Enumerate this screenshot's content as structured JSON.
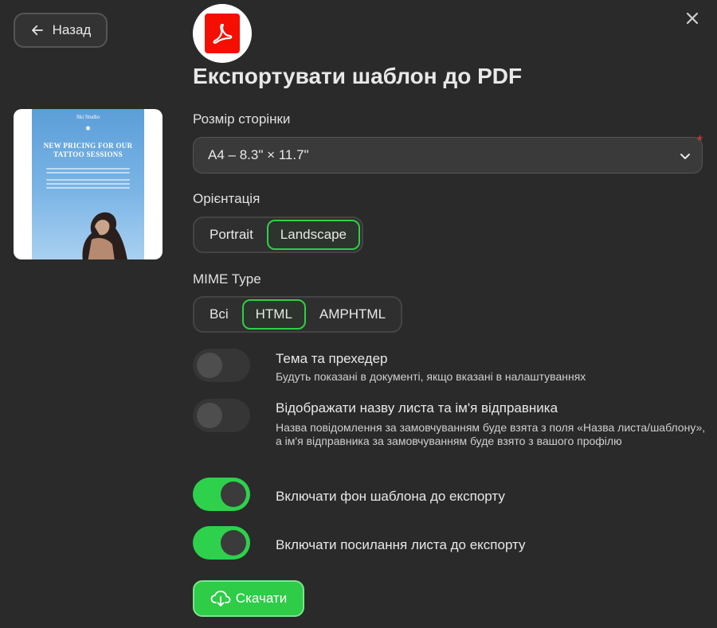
{
  "header": {
    "back_label": "Назад",
    "title": "Експортувати шаблон до PDF"
  },
  "preview": {
    "brand": "Ski Studio",
    "headline": "NEW PRICING FOR OUR TATTOO SESSIONS"
  },
  "page_size": {
    "label": "Розмір сторінки",
    "value": "A4 – 8.3\" × 11.7\"",
    "required_mark": "*"
  },
  "orientation": {
    "label": "Орієнтація",
    "options": [
      "Portrait",
      "Landscape"
    ],
    "selected": "Landscape"
  },
  "mime": {
    "label": "MIME Type",
    "options": [
      "Всі",
      "HTML",
      "AMPHTML"
    ],
    "selected": "HTML"
  },
  "options": [
    {
      "title": "Тема та прехедер",
      "desc": "Будуть показані в документі, якщо вказані в налаштуваннях",
      "on": false
    },
    {
      "title": "Відображати назву листа та ім'я відправника",
      "desc": "Назва повідомлення за замовчуванням буде взята з поля «Назва листа/шаблону», а ім'я відправника за замовчуванням буде взято з вашого профілю",
      "on": false
    },
    {
      "title": "Включати фон шаблона до експорту",
      "desc": "",
      "on": true
    },
    {
      "title": "Включати посилання листа до експорту",
      "desc": "",
      "on": true
    }
  ],
  "download_label": "Скачати",
  "colors": {
    "accent": "#2ecc47",
    "background": "#2a2a2a",
    "pdf_red": "#f40f02"
  },
  "icons": [
    "arrow-left-icon",
    "close-icon",
    "adobe-pdf-icon",
    "chevron-down-icon",
    "cloud-download-icon"
  ]
}
